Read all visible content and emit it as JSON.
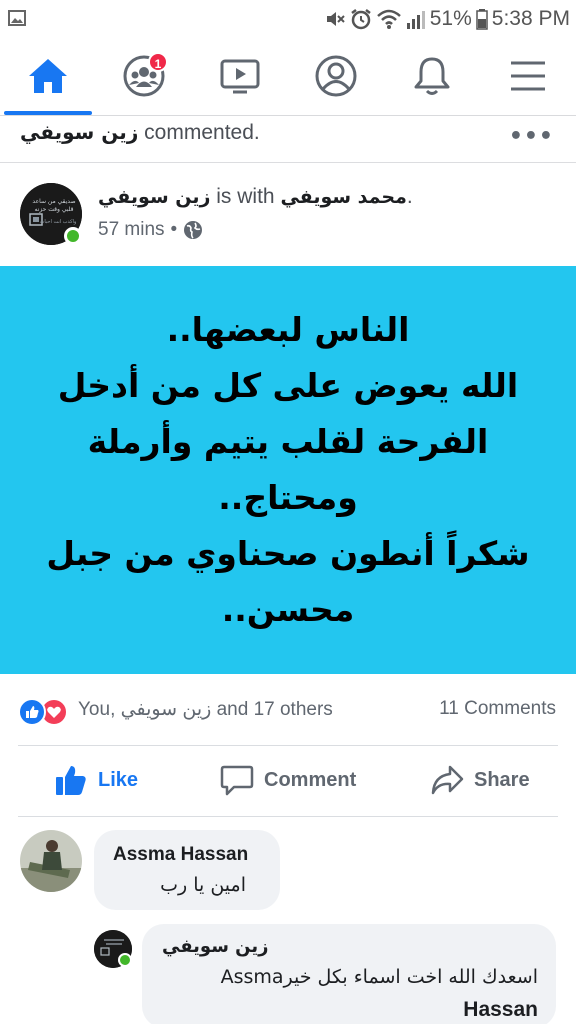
{
  "status_bar": {
    "battery": "51%",
    "time": "5:38 PM",
    "icons": [
      "image-icon",
      "mute-icon",
      "alarm-icon",
      "wifi-icon",
      "signal-icon",
      "battery-icon"
    ]
  },
  "nav": {
    "items": [
      {
        "name": "home",
        "icon": "home-icon",
        "active": true
      },
      {
        "name": "groups",
        "icon": "groups-icon",
        "badge": "1"
      },
      {
        "name": "watch",
        "icon": "video-icon"
      },
      {
        "name": "profile",
        "icon": "profile-icon"
      },
      {
        "name": "notifications",
        "icon": "bell-icon"
      },
      {
        "name": "menu",
        "icon": "hamburger-icon"
      }
    ],
    "accent": "#1877f2"
  },
  "activity": {
    "actor": "زين سويفي",
    "action": " commented."
  },
  "post": {
    "author": "زين سويفي",
    "with_text": " is with ",
    "tagged": "محمد سويفي",
    "period": ".",
    "time": "57 mins",
    "separator": "•",
    "privacy_icon": "globe-icon",
    "avatar_lines": [
      "صديقي من ساعد",
      "قلبي وقت حزنه",
      "واكذب انت احباب"
    ],
    "body_text": "الناس لبعضها..\nالله يعوض على كل من أدخل الفرحة لقلب يتيم وأرملة ومحتاج..\nشكراً أنطون صحناوي من جبل محسن..",
    "background_color": "#23c6ef"
  },
  "reactions": {
    "icons": [
      "like-reaction-icon",
      "love-reaction-icon"
    ],
    "summary": "You, زين سويفي and 17 others",
    "comments_count": "11 Comments"
  },
  "actions": {
    "like": "Like",
    "comment": "Comment",
    "share": "Share"
  },
  "comments": [
    {
      "author": "Assma Hassan",
      "text": "امين يا رب"
    },
    {
      "author": "زين سويفي",
      "text_line1": "اسعدك الله اخت اسماء بكل خيرAssma",
      "text_line2": "Hassan"
    }
  ]
}
